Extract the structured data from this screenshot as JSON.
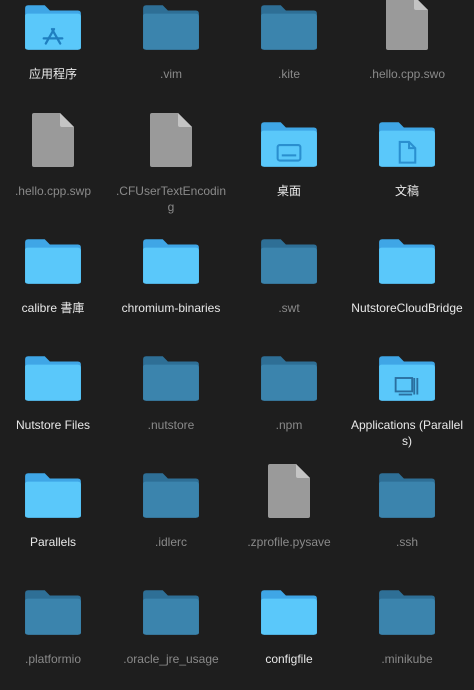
{
  "colors": {
    "background": "#1e1e1e",
    "folder_bright_back": "#3fa6e6",
    "folder_bright_front": "#5ac8fa",
    "folder_dim_back": "#2e6f96",
    "folder_dim_front": "#3b84ad",
    "file_doc": "#9a9a9a"
  },
  "items": [
    {
      "name": "应用程序",
      "icon": "applications-folder-icon",
      "dim": false
    },
    {
      "name": ".vim",
      "icon": "folder-icon",
      "dim": true
    },
    {
      "name": ".kite",
      "icon": "folder-icon",
      "dim": true
    },
    {
      "name": ".hello.cpp.swo",
      "icon": "document-icon",
      "dim": true
    },
    {
      "name": ".hello.cpp.swp",
      "icon": "document-icon",
      "dim": true
    },
    {
      "name": ".CFUserTextEncoding",
      "icon": "document-icon",
      "dim": true
    },
    {
      "name": "桌面",
      "icon": "desktop-folder-icon",
      "dim": false
    },
    {
      "name": "文稿",
      "icon": "documents-folder-icon",
      "dim": false
    },
    {
      "name": "calibre 書庫",
      "icon": "folder-icon",
      "dim": false
    },
    {
      "name": "chromium-binaries",
      "icon": "folder-icon",
      "dim": false
    },
    {
      "name": ".swt",
      "icon": "folder-icon",
      "dim": true
    },
    {
      "name": "NutstoreCloudBridge",
      "icon": "folder-icon",
      "dim": false
    },
    {
      "name": "Nutstore Files",
      "icon": "folder-icon",
      "dim": false
    },
    {
      "name": ".nutstore",
      "icon": "folder-icon",
      "dim": true
    },
    {
      "name": ".npm",
      "icon": "folder-icon",
      "dim": true
    },
    {
      "name": "Applications (Parallels)",
      "icon": "parallels-folder-icon",
      "dim": false
    },
    {
      "name": "Parallels",
      "icon": "folder-icon",
      "dim": false
    },
    {
      "name": ".idlerc",
      "icon": "folder-icon",
      "dim": true
    },
    {
      "name": ".zprofile.pysave",
      "icon": "document-icon",
      "dim": true
    },
    {
      "name": ".ssh",
      "icon": "folder-icon",
      "dim": true
    },
    {
      "name": ".platformio",
      "icon": "folder-icon",
      "dim": true
    },
    {
      "name": ".oracle_jre_usage",
      "icon": "folder-icon",
      "dim": true
    },
    {
      "name": "configfile",
      "icon": "folder-icon",
      "dim": false
    },
    {
      "name": ".minikube",
      "icon": "folder-icon",
      "dim": true
    }
  ]
}
